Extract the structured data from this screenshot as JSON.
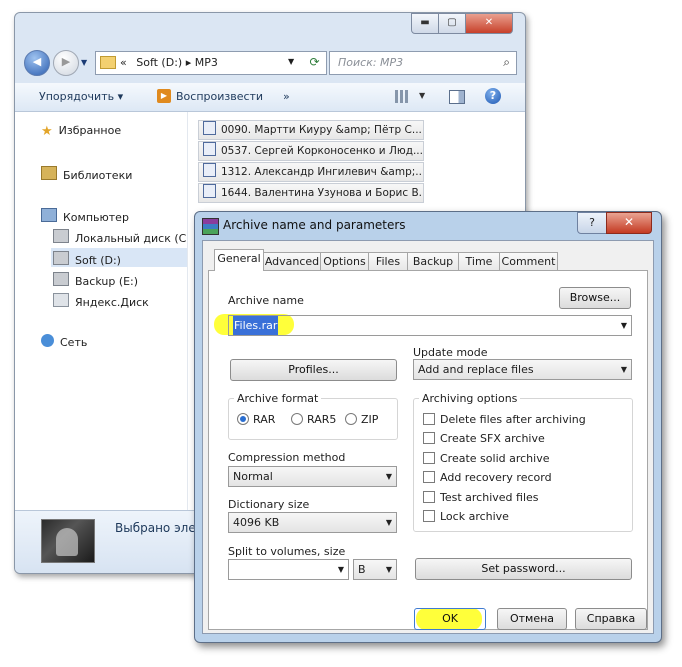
{
  "explorer": {
    "address": {
      "path_prefix": "«",
      "path": "Soft (D:) ▸ MP3"
    },
    "search": {
      "placeholder": "Поиск: MP3"
    },
    "toolbar": {
      "organize_label": "Упорядочить ▾",
      "play_label": "Воспроизвести",
      "more_label": "»"
    },
    "nav": {
      "favorites": "Избранное",
      "libraries": "Библиотеки",
      "computer": "Компьютер",
      "local_disk": "Локальный диск (С",
      "soft": "Soft (D:)",
      "backup": "Backup (E:)",
      "yandex": "Яндекс.Диск",
      "network": "Сеть"
    },
    "files": [
      "0090. Мартти Киуру  &amp; Пётр С...",
      "0537. Сергей Корконосенко и Люд...",
      "1312. Александр Ингилевич  &amp;...",
      "1644. Валентина Узунова и Борис В..."
    ],
    "details_text": "Выбрано эле"
  },
  "dialog": {
    "title": "Archive name and parameters",
    "help_label": "?",
    "close_label": "✕",
    "tabs": [
      "General",
      "Advanced",
      "Options",
      "Files",
      "Backup",
      "Time",
      "Comment"
    ],
    "archive_name_label": "Archive name",
    "browse_label": "Browse...",
    "archive_name_value": "Files.rar",
    "profiles_label": "Profiles...",
    "update_mode_label": "Update mode",
    "update_mode_value": "Add and replace files",
    "archive_format_label": "Archive format",
    "formats": [
      "RAR",
      "RAR5",
      "ZIP"
    ],
    "selected_format": "RAR",
    "compression_method_label": "Compression method",
    "compression_method_value": "Normal",
    "dictionary_size_label": "Dictionary size",
    "dictionary_size_value": "4096 KB",
    "split_label": "Split to volumes, size",
    "split_value": "",
    "split_unit": "B",
    "archiving_options_label": "Archiving options",
    "options": [
      "Delete files after archiving",
      "Create SFX archive",
      "Create solid archive",
      "Add recovery record",
      "Test archived files",
      "Lock archive"
    ],
    "set_password_label": "Set password...",
    "ok_label": "OK",
    "cancel_label": "Отмена",
    "help_button_label": "Справка"
  }
}
